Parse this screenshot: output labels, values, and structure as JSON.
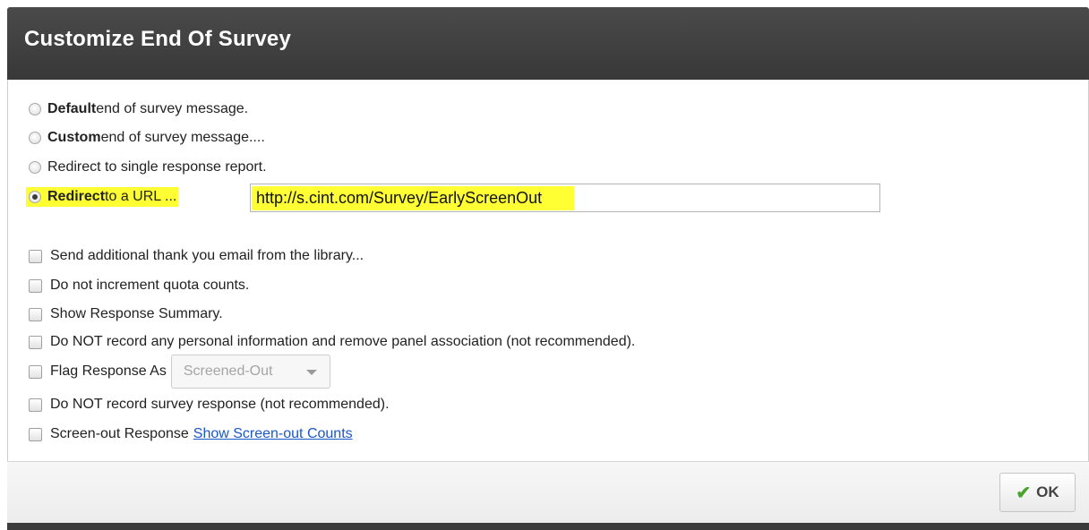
{
  "dialog": {
    "title": "Customize End Of Survey"
  },
  "end_options": [
    {
      "bold": "Default",
      "text": " end of survey message.",
      "checked": false
    },
    {
      "bold": "Custom",
      "text": " end of survey message....",
      "checked": false
    },
    {
      "bold": "",
      "text": "Redirect to single response report.",
      "checked": false
    },
    {
      "bold": "Redirect",
      "text": " to a URL ...",
      "checked": true
    }
  ],
  "redirect_url": {
    "value": "http://s.cint.com/Survey/EarlyScreenOut"
  },
  "checkboxes": {
    "send_email": "Send additional thank you email from the library...",
    "no_quota": "Do not increment quota counts.",
    "show_summary": "Show Response Summary.",
    "no_personal": "Do NOT record any personal information and remove panel association (not recommended).",
    "flag_response": "Flag Response As",
    "no_record": "Do NOT record survey response (not recommended).",
    "screen_out": "Screen-out Response"
  },
  "flag_select": {
    "selected": "Screened-Out"
  },
  "screen_out_link": "Show Screen-out Counts",
  "footer": {
    "ok_label": "OK",
    "ok_icon": "checkmark-icon"
  },
  "colors": {
    "titlebar": "#404040",
    "highlight": "#ffff33",
    "link": "#1a57c8",
    "ok_check": "#4aa52e"
  }
}
